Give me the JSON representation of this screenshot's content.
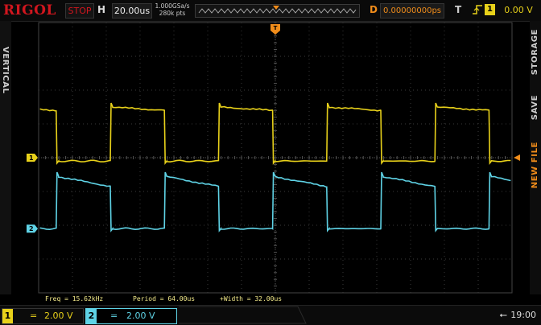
{
  "brand": "RIGOL",
  "status": {
    "run_state": "STOP",
    "horizontal_label": "H",
    "timebase": "20.00us",
    "sample_rate": "1.000GSa/s",
    "memory_depth": "280k pts",
    "delay_label": "D",
    "horizontal_offset": "0.00000000ps",
    "trigger_label": "T",
    "trigger_edge_icon": "rising-edge-icon",
    "trigger_source": "1",
    "trigger_level": "0.00 V"
  },
  "side_tabs": {
    "left": "VERTICAL",
    "right": [
      "STORAGE",
      "SAVE",
      "NEW FILE"
    ]
  },
  "markers": {
    "ch1": "1",
    "ch2": "2",
    "trigger_pos": "T"
  },
  "measurements": [
    {
      "label": "Freq",
      "value": "15.62kHz"
    },
    {
      "label": "Period",
      "value": "64.00us"
    },
    {
      "label": "+Width",
      "value": "32.00us"
    }
  ],
  "channels": [
    {
      "id": "1",
      "coupling": "=",
      "scale": "2.00 V",
      "color": "#e8d11a"
    },
    {
      "id": "2",
      "coupling": "=",
      "scale": "2.00 V",
      "color": "#5fd3e6"
    }
  ],
  "clock": "19:00",
  "colors": {
    "ch1": "#e8d11a",
    "ch2": "#5fd3e6",
    "trigger": "#f08c1a",
    "brand": "#d0161e"
  },
  "waveforms": {
    "period_us": 64,
    "width_us": 32,
    "horizontal_divisions": 14,
    "vertical_divisions": 8,
    "ch1_high_div": 1.5,
    "ch1_low_div": -0.1,
    "ch2_high_div": -0.55,
    "ch2_low_div": -2.1
  }
}
